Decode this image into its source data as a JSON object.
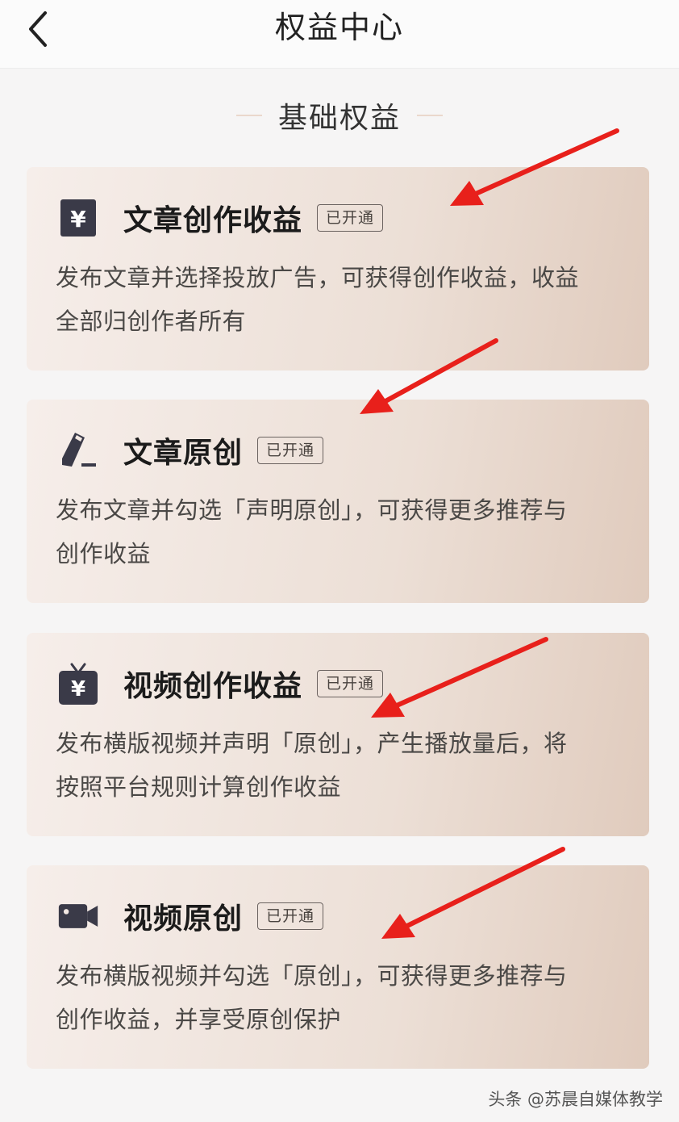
{
  "header": {
    "title": "权益中心",
    "back_icon": "chevron-left-icon"
  },
  "section": {
    "title": "基础权益"
  },
  "cards": [
    {
      "icon": "yuan-card-icon",
      "title": "文章创作收益",
      "badge": "已开通",
      "desc_line1": "发布文章并选择投放广告，可获得创作收益，收益",
      "desc_line2": "全部归创作者所有"
    },
    {
      "icon": "pen-icon",
      "title": "文章原创",
      "badge": "已开通",
      "desc_line1": "发布文章并勾选「声明原创」，可获得更多推荐与",
      "desc_line2": "创作收益"
    },
    {
      "icon": "tv-yuan-icon",
      "title": "视频创作收益",
      "badge": "已开通",
      "desc_line1": "发布横版视频并声明「原创」，产生播放量后，将",
      "desc_line2": "按照平台规则计算创作收益"
    },
    {
      "icon": "video-camera-icon",
      "title": "视频原创",
      "badge": "已开通",
      "desc_line1": "发布横版视频并勾选「原创」，可获得更多推荐与",
      "desc_line2": "创作收益，并享受原创保护"
    }
  ],
  "watermark": "头条 @苏晨自媒体教学",
  "colors": {
    "annotation_arrow": "#e8201b",
    "icon_dark": "#3a3a48",
    "card_gradient_start": "#f6eeea",
    "card_gradient_end": "#e0cbbd"
  }
}
